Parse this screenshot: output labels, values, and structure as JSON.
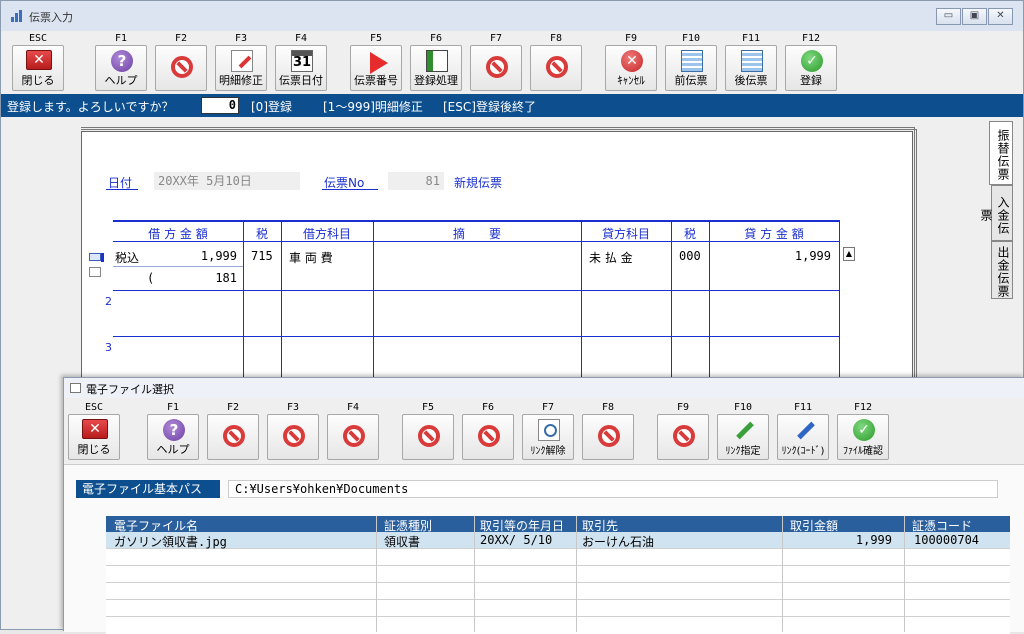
{
  "window": {
    "title": "伝票入力",
    "controls": [
      "▭",
      "▣",
      "✕"
    ]
  },
  "toolbar": [
    {
      "key": "ESC",
      "label": "閉じる",
      "icon": "close-icon"
    },
    {
      "key": "F1",
      "label": "ヘルプ",
      "icon": "help-icon"
    },
    {
      "key": "F2",
      "label": "",
      "icon": "disabled-icon"
    },
    {
      "key": "F3",
      "label": "明細修正",
      "icon": "edit-detail-icon"
    },
    {
      "key": "F4",
      "label": "伝票日付",
      "icon": "calendar-icon",
      "icon_text": "31"
    },
    {
      "key": "F5",
      "label": "伝票番号",
      "icon": "play-icon"
    },
    {
      "key": "F6",
      "label": "登録処理",
      "icon": "register-icon"
    },
    {
      "key": "F7",
      "label": "",
      "icon": "disabled-icon"
    },
    {
      "key": "F8",
      "label": "",
      "icon": "disabled-icon"
    },
    {
      "key": "F9",
      "label": "ｷｬﾝｾﾙ",
      "icon": "cancel-icon"
    },
    {
      "key": "F10",
      "label": "前伝票",
      "icon": "prev-voucher-icon"
    },
    {
      "key": "F11",
      "label": "後伝票",
      "icon": "next-voucher-icon"
    },
    {
      "key": "F12",
      "label": "登録",
      "icon": "confirm-icon"
    }
  ],
  "prompt": {
    "message": "登録します。よろしいですか？",
    "input_value": "0",
    "hint1": "[0]登録",
    "hint2": "[1～999]明細修正",
    "hint3": "[ESC]登録後終了"
  },
  "voucher": {
    "date_label": "日付",
    "date_value": "20XX年 5月10日",
    "no_label": "伝票No",
    "no_value": "81",
    "status": "新規伝票",
    "headers": [
      "借 方 金 額",
      "税",
      "借方科目",
      "摘　　要",
      "貸方科目",
      "税",
      "貸 方 金 額"
    ],
    "row1": {
      "tax_type": "税込",
      "debit_amount": "1,999",
      "debit_tax": "715",
      "debit_account": "車 両 費",
      "credit_account": "未 払 金",
      "credit_tax": "000",
      "credit_amount": "1,999",
      "tax_paren": "(",
      "tax_amount": "181"
    },
    "row_numbers": [
      "2",
      "3"
    ]
  },
  "side_tabs": [
    "振替伝票",
    "入金伝票",
    "出金伝票"
  ],
  "dialog": {
    "title": "電子ファイル選択",
    "toolbar": [
      {
        "key": "ESC",
        "label": "閉じる",
        "icon": "close-icon"
      },
      {
        "key": "F1",
        "label": "ヘルプ",
        "icon": "help-icon"
      },
      {
        "key": "F2",
        "label": "",
        "icon": "disabled-icon"
      },
      {
        "key": "F3",
        "label": "",
        "icon": "disabled-icon"
      },
      {
        "key": "F4",
        "label": "",
        "icon": "disabled-icon"
      },
      {
        "key": "F5",
        "label": "",
        "icon": "disabled-icon"
      },
      {
        "key": "F6",
        "label": "",
        "icon": "disabled-icon"
      },
      {
        "key": "F7",
        "label": "ﾘﾝｸ解除",
        "icon": "unlink-icon"
      },
      {
        "key": "F8",
        "label": "",
        "icon": "disabled-icon"
      },
      {
        "key": "F9",
        "label": "",
        "icon": "disabled-icon"
      },
      {
        "key": "F10",
        "label": "ﾘﾝｸ指定",
        "icon": "link-icon"
      },
      {
        "key": "F11",
        "label": "ﾘﾝｸ(ｺｰﾄﾞ)",
        "icon": "link-code-icon"
      },
      {
        "key": "F12",
        "label": "ﾌｧｲﾙ確認",
        "icon": "file-check-icon"
      }
    ],
    "path_label": "電子ファイル基本パス",
    "path_value": "C:¥Users¥ohken¥Documents",
    "table": {
      "columns": [
        "電子ファイル名",
        "証憑種別",
        "取引等の年月日",
        "取引先",
        "取引金額",
        "証憑コード"
      ],
      "rows": [
        [
          "ガソリン領収書.jpg",
          "領収書",
          "20XX/ 5/10",
          "おーけん石油",
          "1,999",
          "100000704"
        ]
      ]
    }
  }
}
